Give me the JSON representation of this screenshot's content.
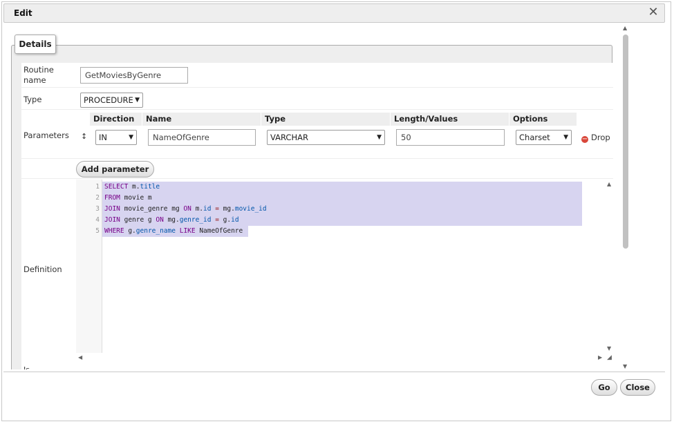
{
  "dialog": {
    "title": "Edit"
  },
  "tab": {
    "label": "Details"
  },
  "form": {
    "routine_name_label": "Routine\nname",
    "routine_name_value": "GetMoviesByGenre",
    "type_label": "Type",
    "type_value": "PROCEDURE",
    "parameters_label": "Parameters",
    "definition_label": "Definition",
    "is_label": "Is"
  },
  "params": {
    "headers": {
      "direction": "Direction",
      "name": "Name",
      "type": "Type",
      "length": "Length/Values",
      "options": "Options"
    },
    "row": {
      "direction": "IN",
      "name": "NameOfGenre",
      "type": "VARCHAR",
      "length": "50",
      "options": "Charset"
    },
    "drop_label": "Drop",
    "add_label": "Add parameter"
  },
  "code": {
    "line_numbers": [
      "1",
      "2",
      "3",
      "4",
      "5"
    ]
  },
  "footer": {
    "go_label": "Go",
    "close_label": "Close"
  },
  "colors": {
    "selection": "#d7d4f0",
    "keyword": "#770088",
    "property": "#0055aa",
    "operator": "#981a1a"
  }
}
